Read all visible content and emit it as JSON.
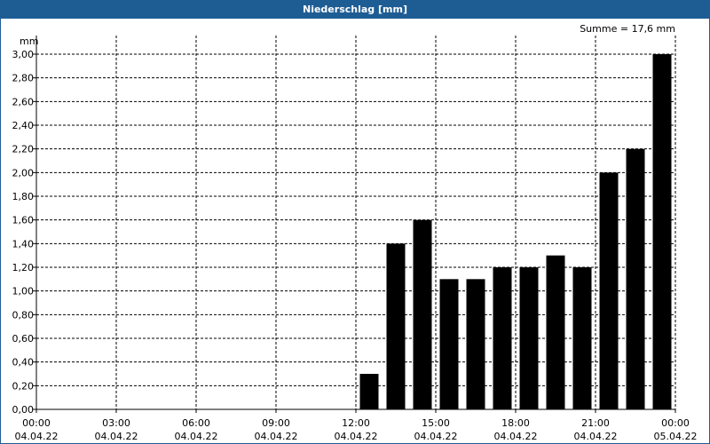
{
  "chart_data": {
    "type": "bar",
    "title": "Niederschlag [mm]",
    "ylabel": "mm",
    "summary": "Summe = 17,6 mm",
    "ylim": [
      0,
      3.0
    ],
    "y_ticks": [
      "0,00",
      "0,20",
      "0,40",
      "0,60",
      "0,80",
      "1,00",
      "1,20",
      "1,40",
      "1,60",
      "1,80",
      "2,00",
      "2,20",
      "2,40",
      "2,60",
      "2,80",
      "3,00"
    ],
    "x_ticks": [
      {
        "time": "00:00",
        "date": "04.04.22"
      },
      {
        "time": "03:00",
        "date": "04.04.22"
      },
      {
        "time": "06:00",
        "date": "04.04.22"
      },
      {
        "time": "09:00",
        "date": "04.04.22"
      },
      {
        "time": "12:00",
        "date": "04.04.22"
      },
      {
        "time": "15:00",
        "date": "04.04.22"
      },
      {
        "time": "18:00",
        "date": "04.04.22"
      },
      {
        "time": "21:00",
        "date": "04.04.22"
      },
      {
        "time": "00:00",
        "date": "05.04.22"
      }
    ],
    "x_start": "04.04.22 00:00",
    "x_end": "05.04.22 00:00",
    "categories": [
      "04.04.22 12:00",
      "04.04.22 13:00",
      "04.04.22 14:00",
      "04.04.22 15:00",
      "04.04.22 16:00",
      "04.04.22 17:00",
      "04.04.22 18:00",
      "04.04.22 19:00",
      "04.04.22 20:00",
      "04.04.22 21:00",
      "04.04.22 22:00",
      "04.04.22 23:00"
    ],
    "values": [
      0.3,
      1.4,
      1.6,
      1.1,
      1.1,
      1.2,
      1.2,
      1.3,
      1.2,
      2.0,
      2.2,
      3.0
    ],
    "grid": true,
    "colors": {
      "bar": "#000000",
      "title_bar": "#1e5d94",
      "grid": "#000000"
    }
  }
}
